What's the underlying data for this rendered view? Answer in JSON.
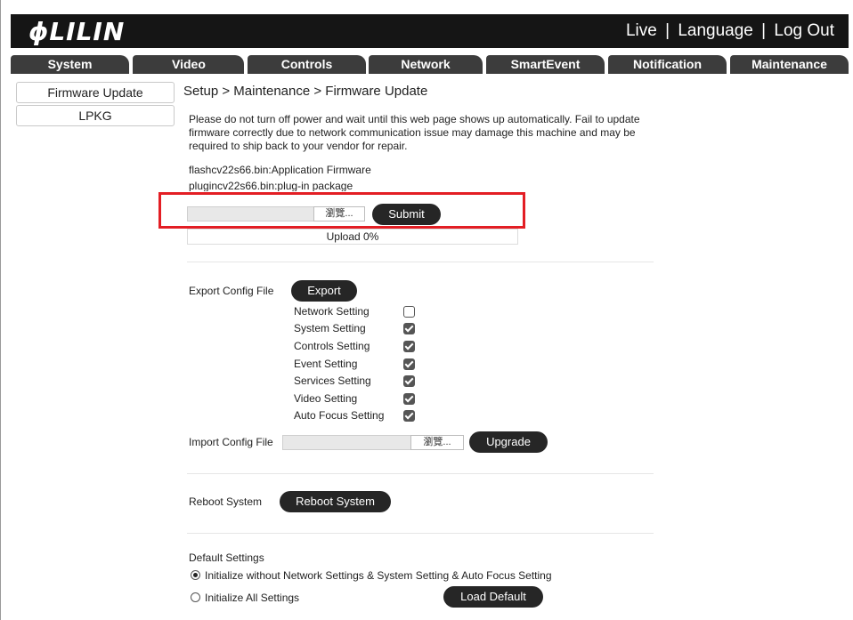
{
  "header": {
    "logo": "LILIN",
    "links": [
      "Live",
      "Language",
      "Log Out"
    ],
    "separator": "|",
    "bg_color": "#151515"
  },
  "nav": {
    "tabs": [
      "System",
      "Video",
      "Controls",
      "Network",
      "SmartEvent",
      "Notification",
      "Maintenance"
    ],
    "tab_color": "#3c3c3c"
  },
  "sidebar": {
    "items": [
      "Firmware Update",
      "LPKG"
    ]
  },
  "breadcrumb": "Setup > Maintenance > Firmware Update",
  "firmware": {
    "notice": "Please do not turn off power and wait until this web page shows up automatically. Fail to update firmware correctly due to network communication issue may damage this machine and may be required to ship back to your vendor for repair.",
    "files": [
      "flashcv22s66.bin:Application Firmware",
      "plugincv22s66.bin:plug-in package"
    ],
    "browse_label": "瀏覽...",
    "submit_label": "Submit",
    "upload_status": "Upload 0%",
    "highlight_color": "#e31e24"
  },
  "export": {
    "label": "Export Config File",
    "button": "Export",
    "options": [
      {
        "label": "Network Setting",
        "checked": false
      },
      {
        "label": "System Setting",
        "checked": true
      },
      {
        "label": "Controls Setting",
        "checked": true
      },
      {
        "label": "Event Setting",
        "checked": true
      },
      {
        "label": "Services Setting",
        "checked": true
      },
      {
        "label": "Video Setting",
        "checked": true
      },
      {
        "label": "Auto Focus Setting",
        "checked": true
      }
    ]
  },
  "import": {
    "label": "Import Config File",
    "browse_label": "瀏覽...",
    "button": "Upgrade"
  },
  "reboot": {
    "label": "Reboot System",
    "button": "Reboot System"
  },
  "defaults": {
    "title": "Default Settings",
    "options": [
      {
        "label": "Initialize without Network Settings & System Setting & Auto Focus Setting",
        "selected": true
      },
      {
        "label": "Initialize All Settings",
        "selected": false
      }
    ],
    "button": "Load Default"
  }
}
